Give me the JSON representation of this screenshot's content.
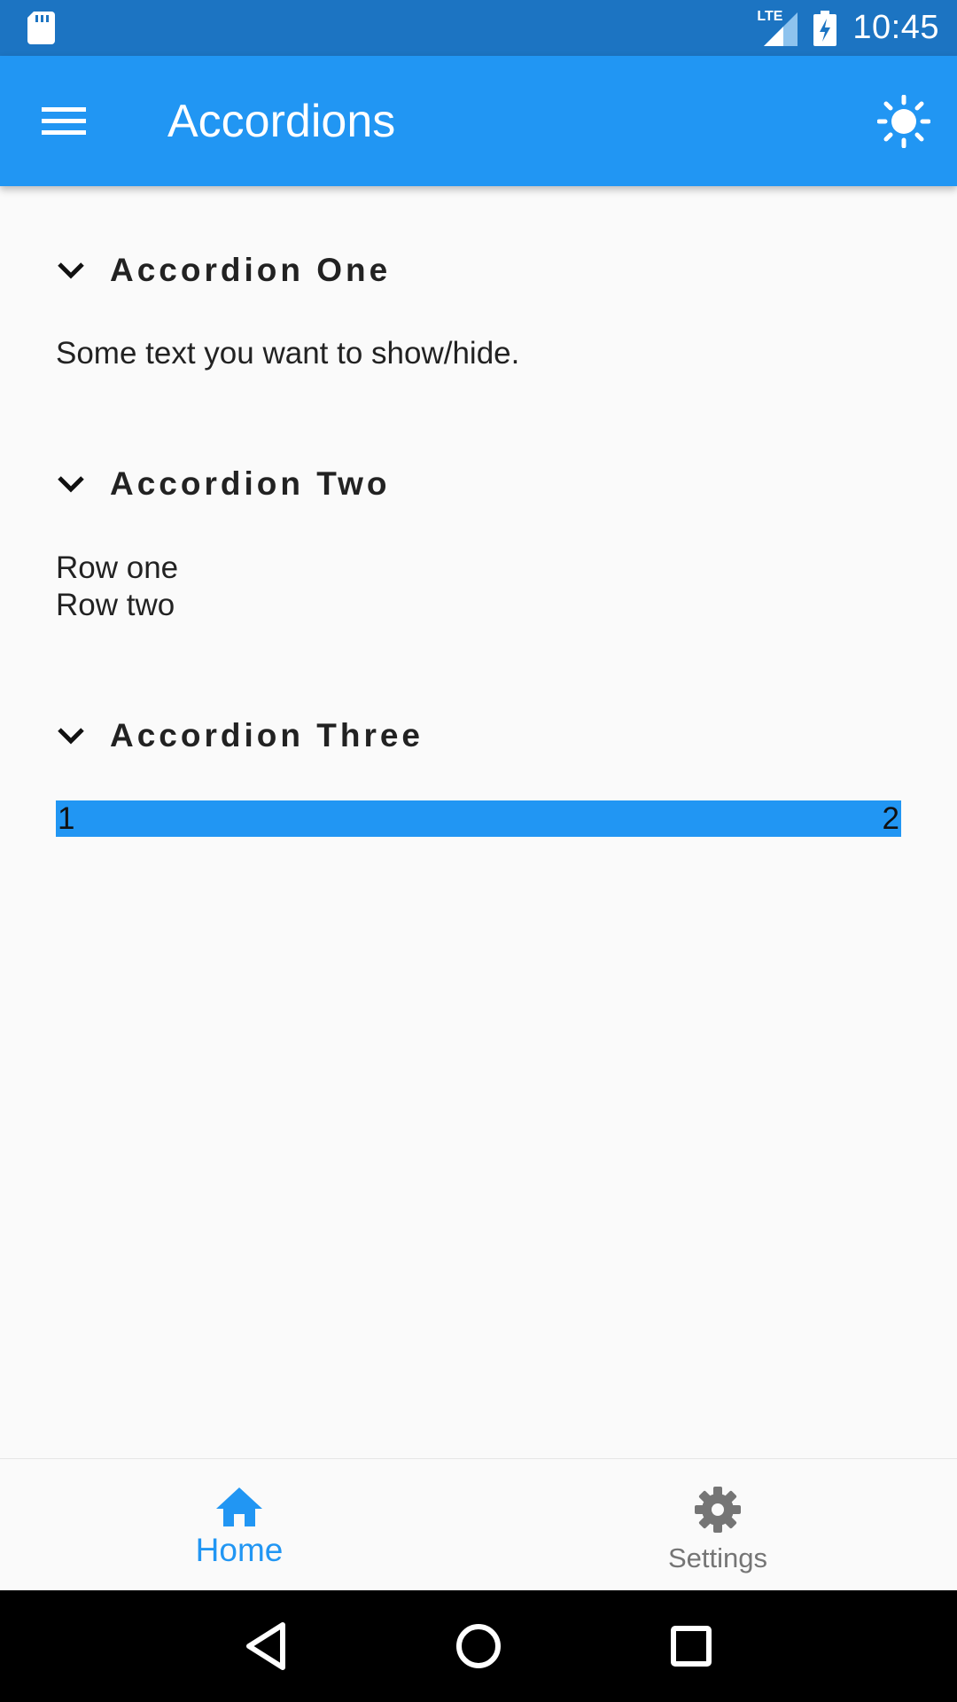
{
  "status_bar": {
    "network": "LTE",
    "time": "10:45"
  },
  "app_bar": {
    "title": "Accordions",
    "menu_icon": "hamburger-menu-icon",
    "theme_icon": "sun-icon"
  },
  "accordions": [
    {
      "title": "Accordion One",
      "expanded": true,
      "body": [
        "Some text you want to show/hide."
      ]
    },
    {
      "title": "Accordion Two",
      "expanded": true,
      "body": [
        "Row one",
        "Row two"
      ]
    },
    {
      "title": "Accordion Three",
      "expanded": true,
      "row": {
        "left": "1",
        "right": "2",
        "color": "#2196f3"
      }
    }
  ],
  "bottom_nav": {
    "items": [
      {
        "label": "Home",
        "icon": "home-icon",
        "active": true
      },
      {
        "label": "Settings",
        "icon": "gear-icon",
        "active": false
      }
    ]
  },
  "system_nav": {
    "back_icon": "back-triangle-icon",
    "home_icon": "home-circle-icon",
    "recents_icon": "recents-square-icon"
  },
  "colors": {
    "primary": "#2196f3",
    "status_bar": "#1c74c2",
    "inactive": "#757575"
  }
}
